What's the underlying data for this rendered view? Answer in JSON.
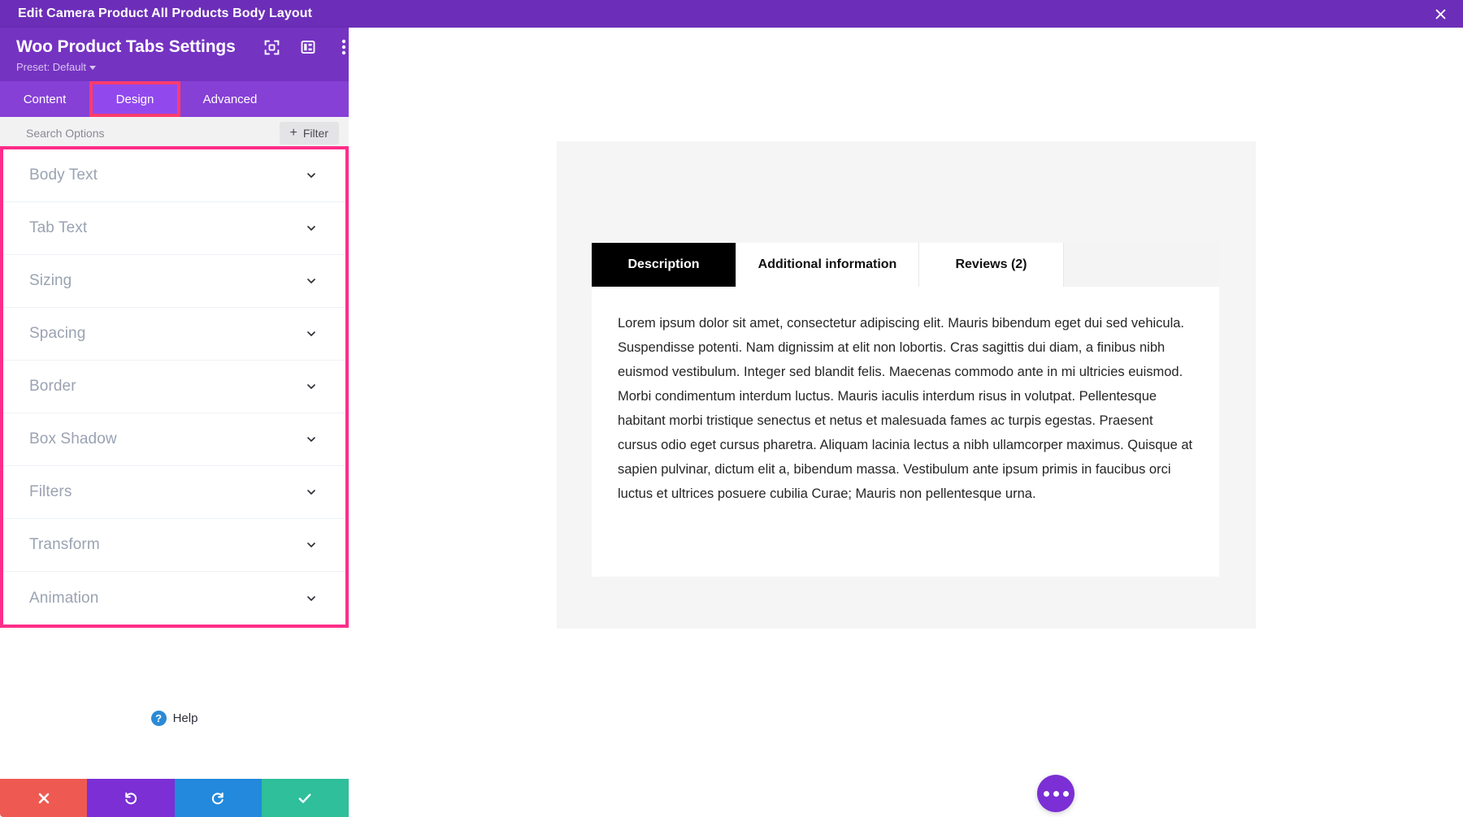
{
  "topbar": {
    "title": "Edit Camera Product All Products Body Layout",
    "close_label": "close-icon"
  },
  "panel": {
    "title": "Woo Product Tabs Settings",
    "preset_label": "Preset: Default",
    "icons": [
      {
        "name": "focus-frame-icon"
      },
      {
        "name": "panel-layout-icon"
      },
      {
        "name": "more-vertical-icon"
      }
    ],
    "tabs": [
      {
        "label": "Content",
        "active": false
      },
      {
        "label": "Design",
        "active": true
      },
      {
        "label": "Advanced",
        "active": false
      }
    ],
    "search": {
      "placeholder": "Search Options",
      "value": ""
    },
    "filter_button": {
      "label": "Filter",
      "plus": "+"
    },
    "sections": [
      {
        "label": "Body Text"
      },
      {
        "label": "Tab Text"
      },
      {
        "label": "Sizing"
      },
      {
        "label": "Spacing"
      },
      {
        "label": "Border"
      },
      {
        "label": "Box Shadow"
      },
      {
        "label": "Filters"
      },
      {
        "label": "Transform"
      },
      {
        "label": "Animation"
      }
    ],
    "help": {
      "badge": "?",
      "label": "Help"
    },
    "actions": [
      {
        "name": "cancel-button",
        "icon": "x-icon"
      },
      {
        "name": "undo-button",
        "icon": "undo-icon"
      },
      {
        "name": "redo-button",
        "icon": "redo-icon"
      },
      {
        "name": "save-button",
        "icon": "check-icon"
      }
    ]
  },
  "preview": {
    "tabs": [
      {
        "label": "Description",
        "active": true
      },
      {
        "label": "Additional information",
        "active": false
      },
      {
        "label": "Reviews (2)",
        "active": false
      }
    ],
    "body_text": "Lorem ipsum dolor sit amet, consectetur adipiscing elit. Mauris bibendum eget dui sed vehicula. Suspendisse potenti. Nam dignissim at elit non lobortis. Cras sagittis dui diam, a finibus nibh euismod vestibulum. Integer sed blandit felis. Maecenas commodo ante in mi ultricies euismod. Morbi condimentum interdum luctus. Mauris iaculis interdum risus in volutpat. Pellentesque habitant morbi tristique senectus et netus et malesuada fames ac turpis egestas. Praesent cursus odio eget cursus pharetra. Aliquam lacinia lectus a nibh ullamcorper maximus. Quisque at sapien pulvinar, dictum elit a, bibendum massa. Vestibulum ante ipsum primis in faucibus orci luctus et ultrices posuere cubilia Curae; Mauris non pellentesque urna.",
    "fab_label": "more-options-fab"
  },
  "colors": {
    "topbar_purple": "#6C2EB8",
    "panel_purple": "#7533C2",
    "tabbar_purple": "#8640D6",
    "active_tab_purple": "#9149EE",
    "highlight_pink": "#FF2D8A",
    "highlight_red": "#FF3C6E",
    "cancel_red": "#EE5A51",
    "undo_purple": "#7B2FD4",
    "redo_blue": "#2289DC",
    "save_green": "#2FBF9B",
    "help_blue": "#2B8AD6"
  }
}
